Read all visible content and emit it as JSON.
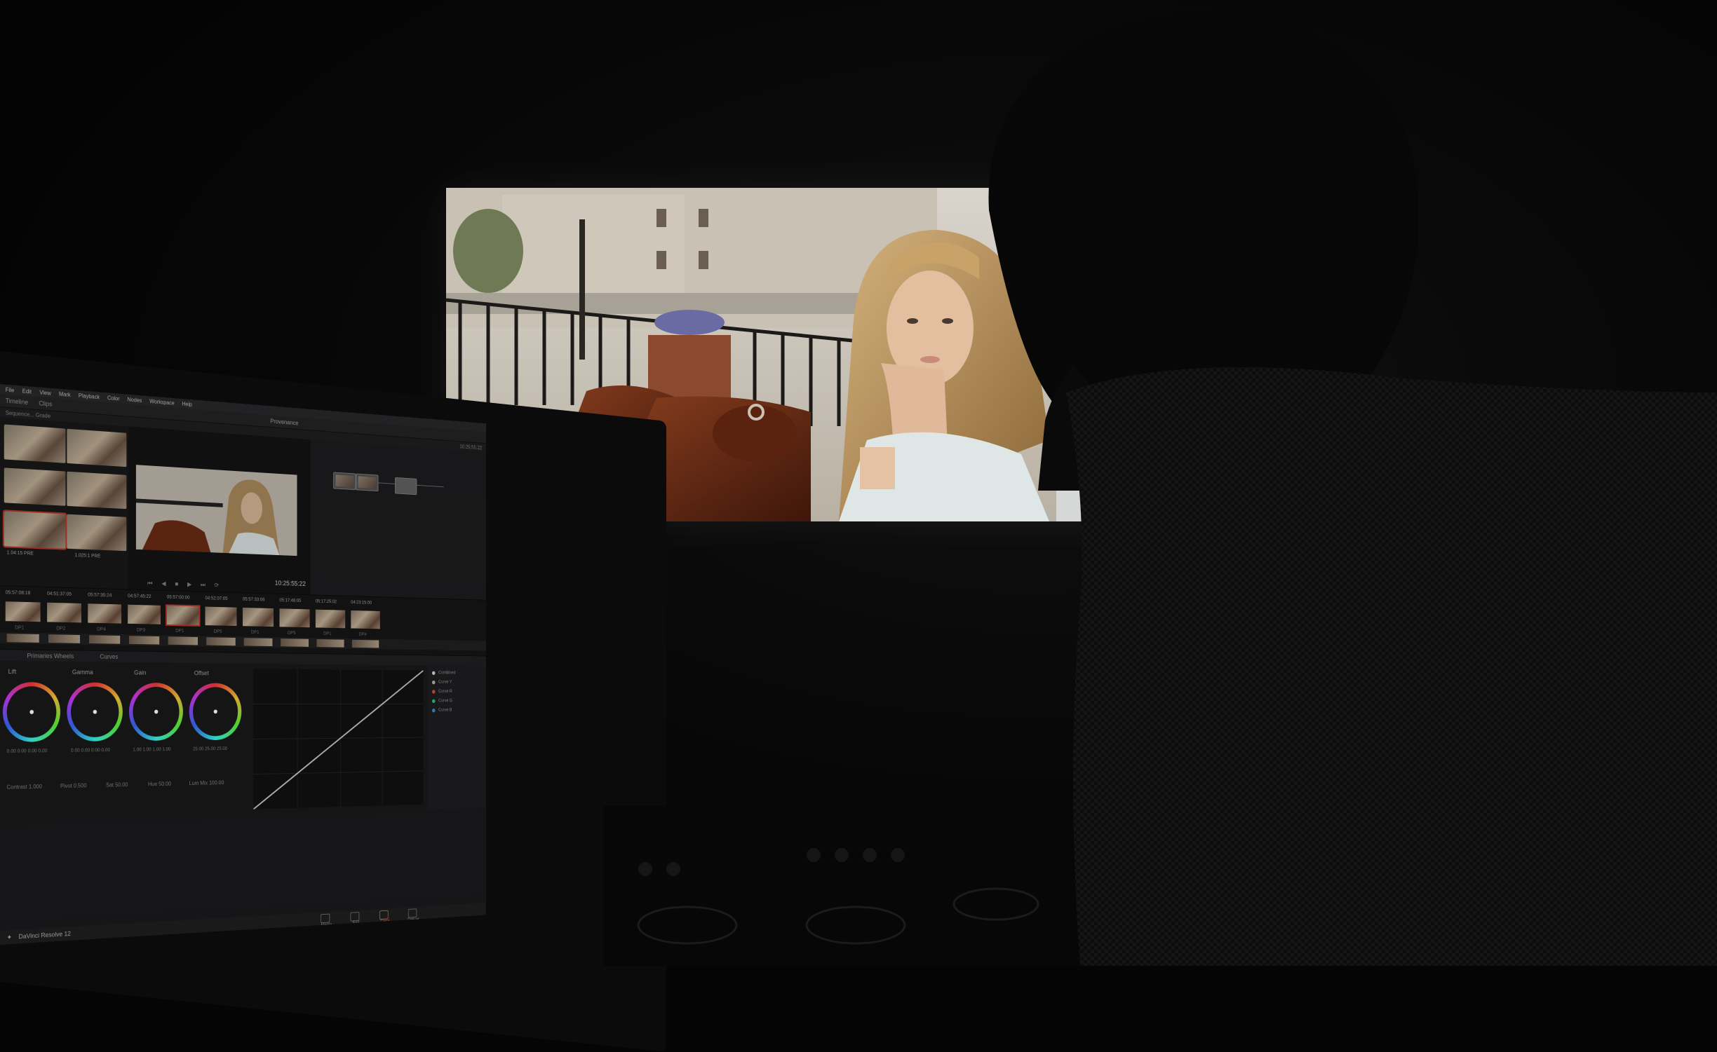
{
  "app": {
    "name": "DaVinci Resolve 12",
    "menu": [
      "File",
      "Edit",
      "View",
      "Mark",
      "Playback",
      "Color",
      "Nodes",
      "Workspace",
      "Help"
    ],
    "tabs": {
      "timeline": "Timeline",
      "clips": "Clips",
      "title": "Provenance"
    },
    "subbar": {
      "sequence": "Sequence... Grade",
      "timecode": "10:25:55:22"
    }
  },
  "gallery": {
    "selected_label": "1.04:15 PRE",
    "second_label": "1.025:1 PRE"
  },
  "viewer": {
    "timecode": "10:25:55:22",
    "transport": "⏮ ◀ ■ ▶ ⏭ ⟳"
  },
  "timeline": {
    "clips": [
      {
        "tc": "05:57:08:18",
        "label": "DP1"
      },
      {
        "tc": "04:51:37:05",
        "label": "DP2"
      },
      {
        "tc": "05:57:35:24",
        "label": "DP4"
      },
      {
        "tc": "04:57:45:22",
        "label": "DP3"
      },
      {
        "tc": "05:57:00:00",
        "label": "DP1"
      },
      {
        "tc": "04:52:07:05",
        "label": "DP5"
      },
      {
        "tc": "05:57:33:06",
        "label": "DP1"
      },
      {
        "tc": "05:17:46:05",
        "label": "DP5"
      },
      {
        "tc": "05:17:25:02",
        "label": "DP1"
      },
      {
        "tc": "04:23:15:00",
        "label": "DP4"
      }
    ]
  },
  "palette": {
    "tabs": [
      "Primaries Wheels",
      "Curves"
    ],
    "wheels": [
      {
        "name": "Lift",
        "values": "0.00  0.00  0.00  0.00"
      },
      {
        "name": "Gamma",
        "values": "0.00  0.00  0.00  0.00"
      },
      {
        "name": "Gain",
        "values": "1.00  1.00  1.00  1.00"
      },
      {
        "name": "Offset",
        "values": "25.00  25.00  25.00"
      }
    ],
    "params": {
      "contrast": "Contrast 1.000",
      "pivot": "Pivot 0.500",
      "sat": "Sat 50.00",
      "hue": "Hue 50.00",
      "lum": "Lum Mix 100.00"
    },
    "curve_channels": [
      "Combined",
      "Curve Y",
      "Curve R",
      "Curve G",
      "Curve B"
    ]
  },
  "footer": {
    "pages": [
      "Media",
      "Edit",
      "Color",
      "Deliver"
    ],
    "active_page": "Color"
  },
  "colors": {
    "accent": "#e8664a",
    "selection": "#c0392b",
    "ui_bg": "#1c1c1e"
  }
}
